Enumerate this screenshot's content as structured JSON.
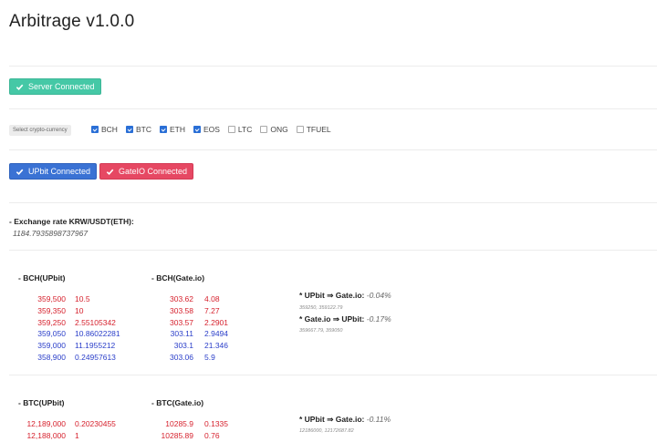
{
  "app": {
    "title": "Arbitrage v1.0.0"
  },
  "server": {
    "status_label": "Server Connected"
  },
  "crypto_select": {
    "label": "Select crypto-currency",
    "options": [
      {
        "label": "BCH",
        "checked": true
      },
      {
        "label": "BTC",
        "checked": true
      },
      {
        "label": "ETH",
        "checked": true
      },
      {
        "label": "EOS",
        "checked": true
      },
      {
        "label": "LTC",
        "checked": false
      },
      {
        "label": "ONG",
        "checked": false
      },
      {
        "label": "TFUEL",
        "checked": false
      }
    ]
  },
  "exchanges": {
    "upbit_label": "UPbit Connected",
    "gateio_label": "GateIO Connected"
  },
  "exchange_rate": {
    "label": "- Exchange rate KRW/USDT(ETH):",
    "value": "1184.7935898737967"
  },
  "books": [
    {
      "upbit_header": "- BCH(UPbit)",
      "gate_header": "- BCH(Gate.io)",
      "upbit_rows": [
        {
          "price": "359,500",
          "qty": "10.5",
          "side": "ask"
        },
        {
          "price": "359,350",
          "qty": "10",
          "side": "ask"
        },
        {
          "price": "359,250",
          "qty": "2.55105342",
          "side": "ask"
        },
        {
          "price": "359,050",
          "qty": "10.86022281",
          "side": "bid"
        },
        {
          "price": "359,000",
          "qty": "11.1955212",
          "side": "bid"
        },
        {
          "price": "358,900",
          "qty": "0.24957613",
          "side": "bid"
        }
      ],
      "gate_rows": [
        {
          "price": "303.62",
          "qty": "4.08",
          "side": "ask"
        },
        {
          "price": "303.58",
          "qty": "7.27",
          "side": "ask"
        },
        {
          "price": "303.57",
          "qty": "2.2901",
          "side": "ask"
        },
        {
          "price": "303.11",
          "qty": "2.9494",
          "side": "bid"
        },
        {
          "price": "303.1",
          "qty": "21.346",
          "side": "bid"
        },
        {
          "price": "303.06",
          "qty": "5.9",
          "side": "bid"
        }
      ],
      "arb": [
        {
          "label": "* UPbit ⇒ Gate.io:",
          "pct": "-0.04%",
          "detail": "359250, 359122.79"
        },
        {
          "label": "* Gate.io ⇒ UPbit:",
          "pct": "-0.17%",
          "detail": "359667.79, 359050"
        }
      ]
    },
    {
      "upbit_header": "- BTC(UPbit)",
      "gate_header": "- BTC(Gate.io)",
      "upbit_rows": [
        {
          "price": "12,189,000",
          "qty": "0.20230455",
          "side": "ask"
        },
        {
          "price": "12,188,000",
          "qty": "1",
          "side": "ask"
        }
      ],
      "gate_rows": [
        {
          "price": "10285.9",
          "qty": "0.1335",
          "side": "ask"
        },
        {
          "price": "10285.89",
          "qty": "0.76",
          "side": "ask"
        }
      ],
      "arb": [
        {
          "label": "* UPbit ⇒ Gate.io:",
          "pct": "-0.11%",
          "detail": "12186000, 12172687.82"
        }
      ]
    }
  ],
  "colors": {
    "ask": "#d6212d",
    "bid": "#2a3ec9",
    "green": "#45c8a6",
    "blue": "#3a72d4",
    "red": "#e64863"
  }
}
